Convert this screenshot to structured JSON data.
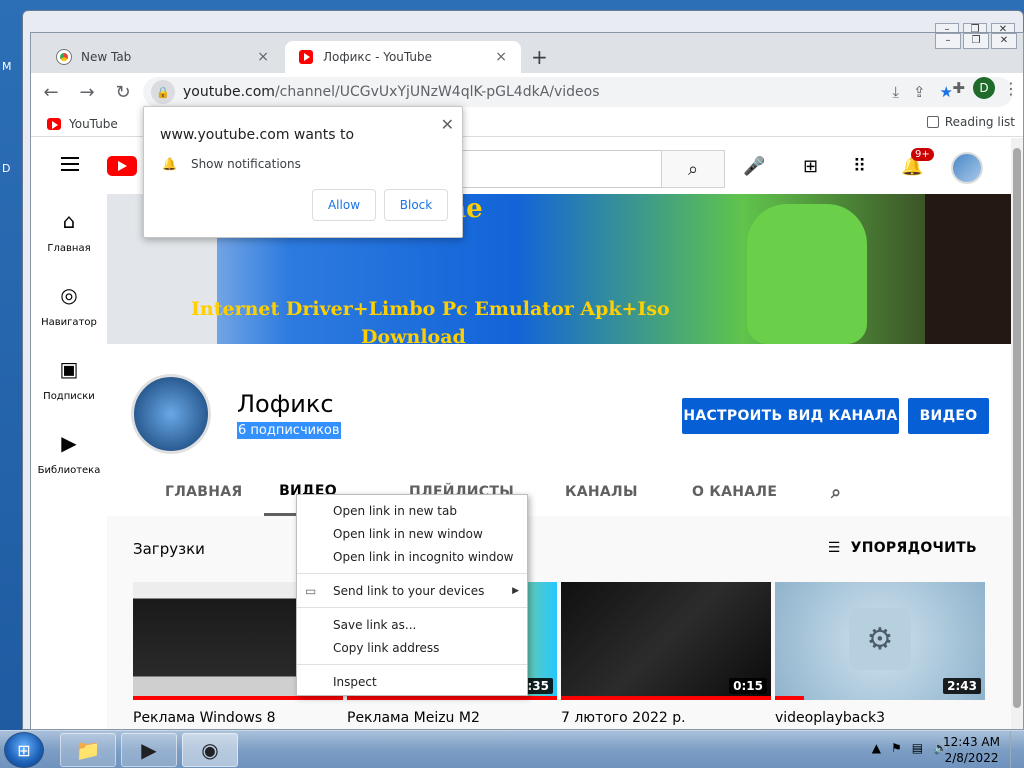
{
  "browser": {
    "tabs": [
      {
        "title": "New Tab",
        "close": "×"
      },
      {
        "title": "Лофикс - YouTube",
        "close": "×"
      }
    ],
    "new_tab": "+",
    "url_host": "youtube.com",
    "url_path": "/channel/UCGvUxYjUNzW4qlK-pGL4dkA/videos",
    "profile_initial": "D",
    "bookmarks": [
      {
        "label": "YouTube"
      }
    ],
    "reading_list": "Reading list"
  },
  "notification": {
    "title": "www.youtube.com wants to",
    "permission": "Show notifications",
    "allow": "Allow",
    "block": "Block"
  },
  "youtube": {
    "notification_count": "9+",
    "sidebar": [
      {
        "label": "Главная",
        "icon": "home-icon"
      },
      {
        "label": "Навигатор",
        "icon": "compass-icon"
      },
      {
        "label": "Подписки",
        "icon": "subscriptions-icon"
      },
      {
        "label": "Библиотека",
        "icon": "library-icon"
      }
    ],
    "banner": {
      "line1": "Machine",
      "line2": "Internet Driver+Limbo Pc Emulator Apk+Iso",
      "line3": "Download"
    },
    "channel": {
      "name": "Лофикс",
      "subscribers": "6 подписчиков",
      "customize_button": "НАСТРОИТЬ ВИД КАНАЛА",
      "video_button": "ВИДЕО"
    },
    "channel_tabs": [
      "ГЛАВНАЯ",
      "ВИДЕО",
      "ПЛЕЙЛИСТЫ",
      "КАНАЛЫ",
      "О КАНАЛЕ"
    ],
    "active_tab": "ВИДЕО",
    "section_title": "Загрузки",
    "sort_label": "УПОРЯДОЧИТЬ",
    "videos": [
      {
        "title": "Реклама Windows 8",
        "duration": ""
      },
      {
        "title": "Реклама Meizu M2",
        "duration": ":35"
      },
      {
        "title": "7 лютого 2022 р.",
        "duration": "0:15"
      },
      {
        "title": "videoplayback3",
        "duration": "2:43"
      }
    ]
  },
  "context_menu": {
    "items": [
      "Open link in new tab",
      "Open link in new window",
      "Open link in incognito window",
      "Send link to your devices",
      "Save link as...",
      "Copy link address",
      "Inspect"
    ]
  },
  "taskbar": {
    "time": "12:43 AM",
    "date": "2/8/2022"
  }
}
